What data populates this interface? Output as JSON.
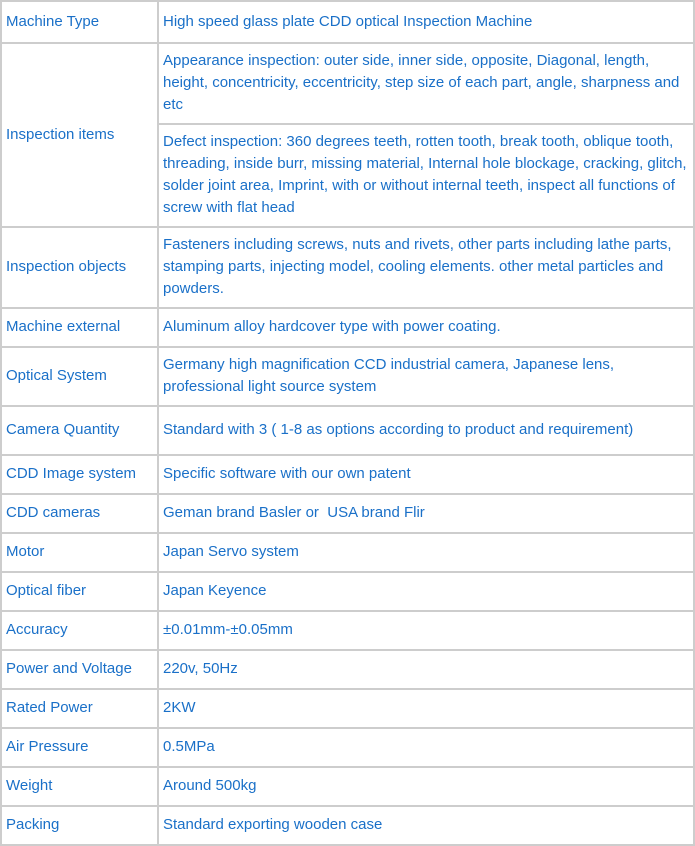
{
  "spec_table": {
    "text_color": "#1a70c8",
    "border_color": "#cdcdcd",
    "rows": [
      {
        "label": "Machine Type",
        "values": [
          "High speed glass plate CDD optical Inspection Machine"
        ]
      },
      {
        "label": "Inspection items",
        "values": [
          "Appearance inspection: outer side, inner side, opposite, Diagonal, length, height, concentricity, eccentricity, step size of each part, angle, sharpness and etc",
          "Defect inspection: 360 degrees teeth, rotten tooth, break tooth, oblique tooth, threading, inside burr, missing material, Internal hole blockage, cracking, glitch, solder joint area, Imprint, with or without internal teeth, inspect all functions of screw with flat head"
        ]
      },
      {
        "label": "Inspection objects",
        "values": [
          "Fasteners including screws, nuts and rivets, other parts including lathe parts, stamping parts, injecting model, cooling elements. other metal particles and powders."
        ]
      },
      {
        "label": "Machine external",
        "values": [
          "Aluminum alloy hardcover type with power coating."
        ]
      },
      {
        "label": "Optical System",
        "values": [
          "Germany high magnification CCD industrial camera, Japanese lens, professional light source system"
        ]
      },
      {
        "label": "Camera Quantity",
        "values": [
          "Standard with 3 ( 1-8 as options according to product and requirement)"
        ]
      },
      {
        "label": "CDD Image system",
        "values": [
          "Specific software with our own patent"
        ]
      },
      {
        "label": "CDD cameras",
        "values": [
          "Geman brand Basler or  USA brand Flir"
        ]
      },
      {
        "label": "Motor",
        "values": [
          "Japan Servo system"
        ]
      },
      {
        "label": "Optical fiber",
        "values": [
          "Japan Keyence"
        ]
      },
      {
        "label": "Accuracy",
        "values": [
          "±0.01mm-±0.05mm"
        ]
      },
      {
        "label": "Power and Voltage",
        "values": [
          "220v, 50Hz"
        ]
      },
      {
        "label": "Rated Power",
        "values": [
          "2KW"
        ]
      },
      {
        "label": "Air Pressure",
        "values": [
          "0.5MPa"
        ]
      },
      {
        "label": "Weight",
        "values": [
          "Around 500kg"
        ]
      },
      {
        "label": "Packing",
        "values": [
          "Standard exporting wooden case"
        ]
      }
    ]
  }
}
